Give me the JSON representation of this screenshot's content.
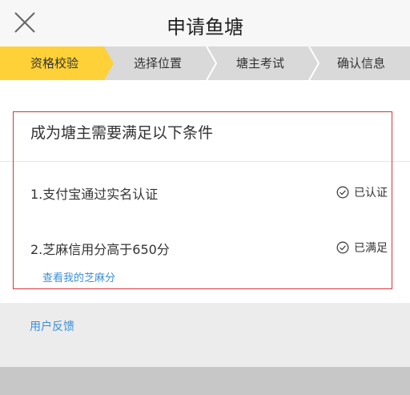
{
  "header": {
    "title": "申请鱼塘"
  },
  "steps": [
    {
      "label": "资格校验"
    },
    {
      "label": "选择位置"
    },
    {
      "label": "塘主考试"
    },
    {
      "label": "确认信息"
    }
  ],
  "colors": {
    "active_step": "#fed138",
    "inactive_step": "#d9d9d9",
    "highlight_border": "#d9333f",
    "link": "#3b8fd6"
  },
  "requirements": {
    "title": "成为塘主需要满足以下条件",
    "items": [
      {
        "text": "1.支付宝通过实名认证",
        "status": "已认证",
        "icon": "check-circle-icon"
      },
      {
        "text": "2.芝麻信用分高于650分",
        "status": "已满足",
        "icon": "check-circle-icon"
      }
    ],
    "link": "查看我的芝麻分"
  },
  "feedback": {
    "label": "用户反馈"
  }
}
